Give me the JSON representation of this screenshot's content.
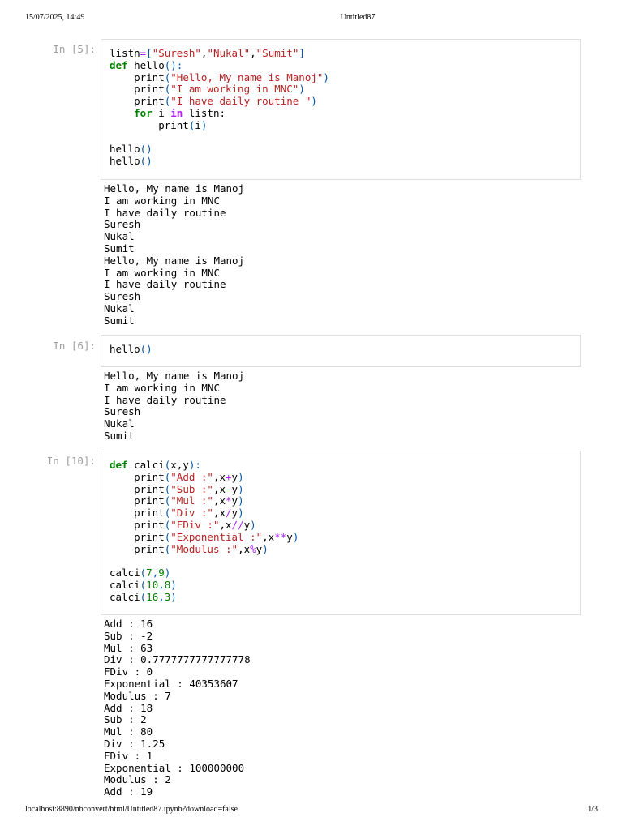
{
  "header": {
    "date": "15/07/2025, 14:49",
    "title": "Untitled87"
  },
  "footer": {
    "url": "localhost:8890/nbconvert/html/Untitled87.ipynb?download=false",
    "page": "1/3"
  },
  "cells": [
    {
      "prompt": "In [5]:",
      "outputs": [
        "Hello, My name is Manoj",
        "I am working in MNC",
        "I have daily routine",
        "Suresh",
        "Nukal",
        "Sumit",
        "Hello, My name is Manoj",
        "I am working in MNC",
        "I have daily routine",
        "Suresh",
        "Nukal",
        "Sumit"
      ]
    },
    {
      "prompt": "In [6]:",
      "outputs": [
        "Hello, My name is Manoj",
        "I am working in MNC",
        "I have daily routine",
        "Suresh",
        "Nukal",
        "Sumit"
      ]
    },
    {
      "prompt": "In [10]:",
      "outputs": [
        "Add : 16",
        "Sub : -2",
        "Mul : 63",
        "Div : 0.7777777777777778",
        "FDiv : 0",
        "Exponential : 40353607",
        "Modulus : 7",
        "Add : 18",
        "Sub : 2",
        "Mul : 80",
        "Div : 1.25",
        "FDiv : 1",
        "Exponential : 100000000",
        "Modulus : 2",
        "Add : 19"
      ]
    }
  ],
  "code": {
    "c1_l1": [
      "listn",
      "=",
      "[",
      "\"Suresh\"",
      ",",
      "\"Nukal\"",
      ",",
      "\"Sumit\"",
      "]"
    ],
    "c1_l2": [
      "def",
      " hello",
      "():"
    ],
    "c1_l3": [
      "    print",
      "(",
      "\"Hello, My name is Manoj\"",
      ")"
    ],
    "c1_l4": [
      "    print",
      "(",
      "\"I am working in MNC\"",
      ")"
    ],
    "c1_l5": [
      "    print",
      "(",
      "\"I have daily routine \"",
      ")"
    ],
    "c1_l6": [
      "    ",
      "for",
      " i ",
      "in",
      " listn:"
    ],
    "c1_l7": [
      "        print",
      "(",
      "i",
      ")"
    ],
    "c1_l9": [
      "hello",
      "()"
    ],
    "c1_l10": [
      "hello",
      "()"
    ],
    "c2_l1": [
      "hello",
      "()"
    ],
    "c3_l1": [
      "def",
      " calci",
      "(",
      "x,y",
      "):"
    ],
    "c3_l2": [
      "    print",
      "(",
      "\"Add :\"",
      ",x",
      "+",
      "y",
      ")"
    ],
    "c3_l3": [
      "    print",
      "(",
      "\"Sub :\"",
      ",x",
      "-",
      "y",
      ")"
    ],
    "c3_l4": [
      "    print",
      "(",
      "\"Mul :\"",
      ",x",
      "*",
      "y",
      ")"
    ],
    "c3_l5": [
      "    print",
      "(",
      "\"Div :\"",
      ",x",
      "/",
      "y",
      ")"
    ],
    "c3_l6": [
      "    print",
      "(",
      "\"FDiv :\"",
      ",x",
      "//",
      "y",
      ")"
    ],
    "c3_l7": [
      "    print",
      "(",
      "\"Exponential :\"",
      ",x",
      "**",
      "y",
      ")"
    ],
    "c3_l8": [
      "    print",
      "(",
      "\"Modulus :\"",
      ",x",
      "%",
      "y",
      ")"
    ],
    "c3_l10": [
      "calci",
      "(",
      "7",
      ",",
      "9",
      ")"
    ],
    "c3_l11": [
      "calci",
      "(",
      "10",
      ",",
      "8",
      ")"
    ],
    "c3_l12": [
      "calci",
      "(",
      "16",
      ",",
      "3",
      ")"
    ]
  }
}
